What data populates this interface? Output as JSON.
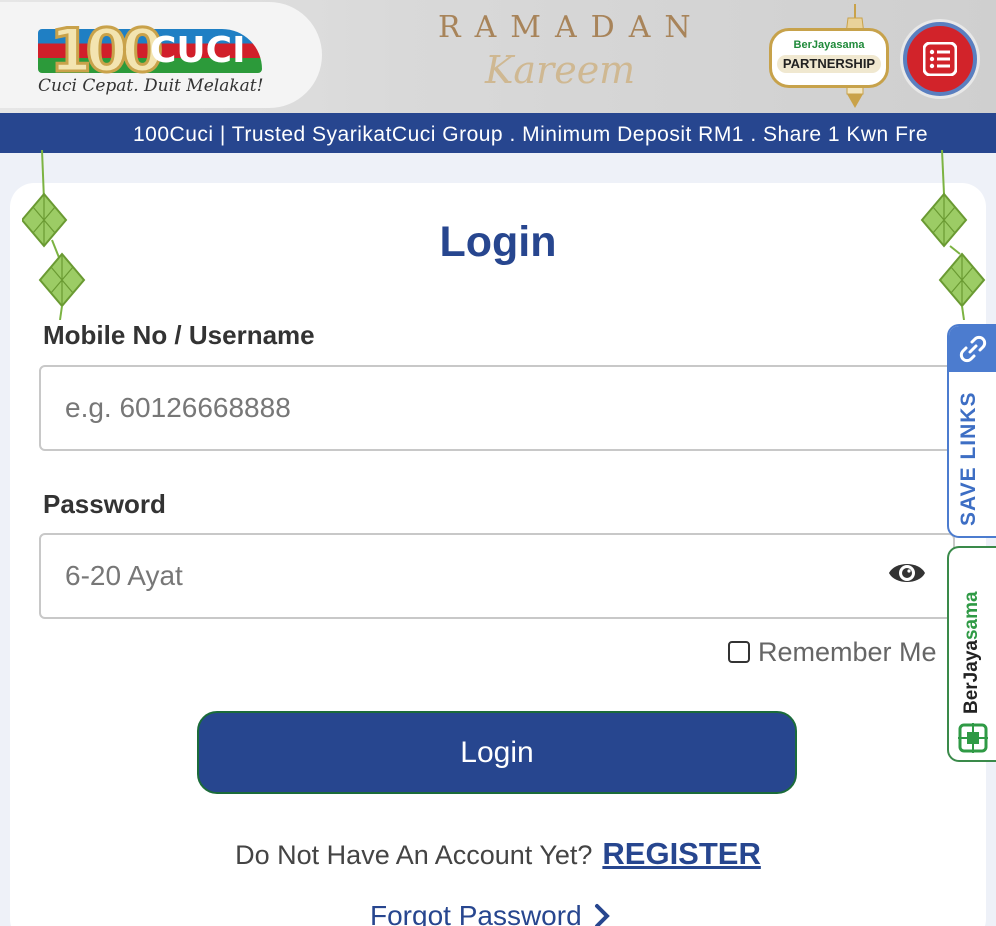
{
  "header": {
    "logo_number": "100",
    "logo_word": "CUCI",
    "tagline": "Cuci Cepat. Duit Melakat!",
    "banner_title": "RAMADAN",
    "banner_script": "Kareem",
    "partner_brand": "BerJayasama",
    "partner_label": "PARTNERSHIP"
  },
  "marquee": {
    "text": "100Cuci | Trusted SyarikatCuci Group . Minimum Deposit RM1 . Share 1 Kwn Fre"
  },
  "form": {
    "title": "Login",
    "username_label": "Mobile No / Username",
    "username_placeholder": "e.g. 60126668888",
    "password_label": "Password",
    "password_placeholder": "6-20 Ayat",
    "remember_label": "Remember Me",
    "login_button": "Login",
    "no_account_text": "Do Not Have An Account Yet?",
    "register_link": "REGISTER",
    "forgot_link": "Forgot Password"
  },
  "side_tabs": {
    "save_links": "SAVE LINKS",
    "bjs_part1": "Ber",
    "bjs_part2": "Jaya",
    "bjs_part3": "sama"
  },
  "colors": {
    "primary_blue": "#27468f",
    "accent_red": "#d2232a",
    "partner_green": "#2f9a45",
    "save_tab_blue": "#4c7ccf"
  }
}
